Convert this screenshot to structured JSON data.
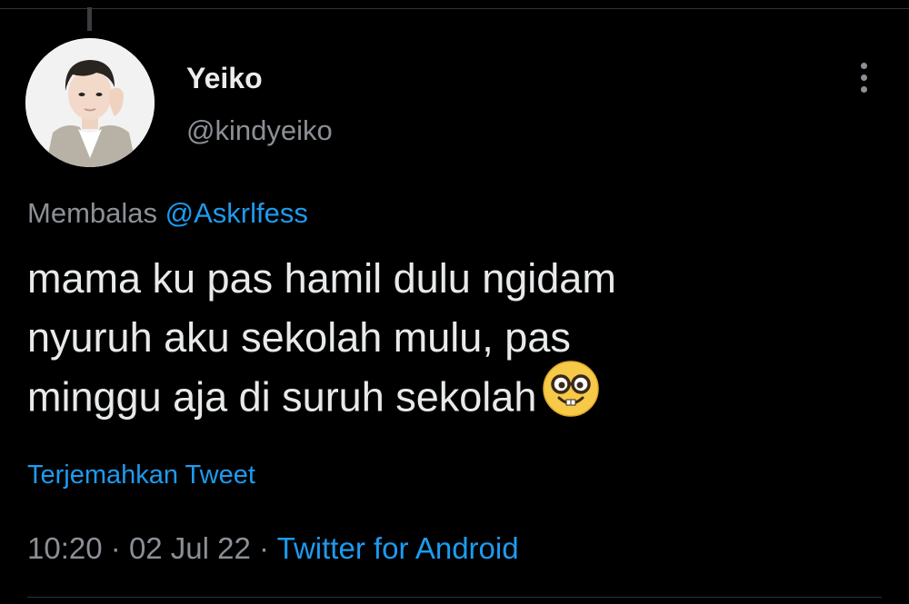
{
  "author": {
    "display_name": "Yeiko",
    "handle": "@kindyeiko"
  },
  "reply": {
    "prefix": "Membalas",
    "mention": "@Askrlfess"
  },
  "tweet": {
    "lines": [
      "mama ku pas hamil dulu ngidam",
      "nyuruh aku sekolah mulu, pas",
      "minggu aja di suruh sekolah"
    ],
    "emoji": "nerd-face-emoji"
  },
  "translate_label": "Terjemahkan Tweet",
  "meta": {
    "time": "10:20",
    "separator": "·",
    "date": "02 Jul 22",
    "source": "Twitter for Android"
  },
  "icons": {
    "more": "more-vertical-icon"
  },
  "colors": {
    "background": "#000000",
    "text": "#e7e9ea",
    "secondary": "#8b9096",
    "accent": "#1d9bf0"
  }
}
